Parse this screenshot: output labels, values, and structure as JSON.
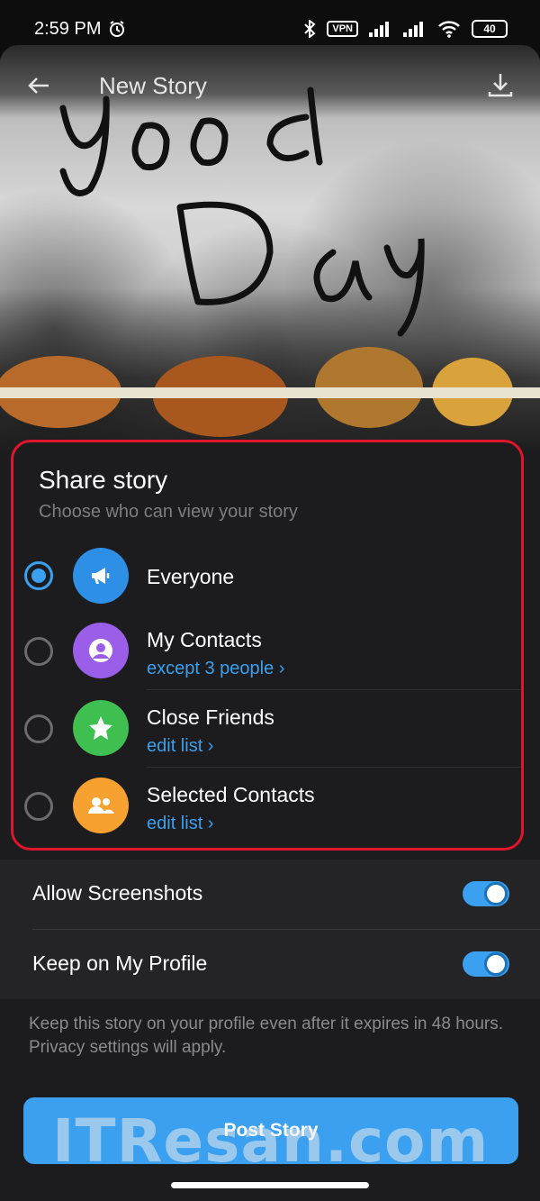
{
  "status_bar": {
    "time": "2:59 PM",
    "alarm_icon": "alarm-clock-icon",
    "vpn": "VPN",
    "battery": "40"
  },
  "header": {
    "title": "New Story",
    "back_icon": "arrow-left-icon",
    "download_icon": "download-icon"
  },
  "share": {
    "title": "Share story",
    "subtitle": "Choose who can view your story",
    "options": [
      {
        "label": "Everyone",
        "sub": "",
        "icon": "megaphone-icon",
        "color": "#2e8fe6",
        "selected": true
      },
      {
        "label": "My Contacts",
        "sub": "except 3 people ›",
        "icon": "user-circle-icon",
        "color": "#9a5ee8",
        "selected": false
      },
      {
        "label": "Close Friends",
        "sub": "edit list ›",
        "icon": "star-icon",
        "color": "#3fbf4f",
        "selected": false
      },
      {
        "label": "Selected Contacts",
        "sub": "edit list ›",
        "icon": "users-icon",
        "color": "#f6a130",
        "selected": false
      }
    ]
  },
  "settings": {
    "allow_screenshots": {
      "label": "Allow Screenshots",
      "on": true
    },
    "keep_on_profile": {
      "label": "Keep on My Profile",
      "on": true
    }
  },
  "hint": "Keep this story on your profile even after it expires in 48 hours. Privacy settings will apply.",
  "post_button": "Post Story",
  "watermark": "ITResan.com",
  "colors": {
    "accent": "#3aa0ef",
    "highlight_border": "#e0142b"
  }
}
